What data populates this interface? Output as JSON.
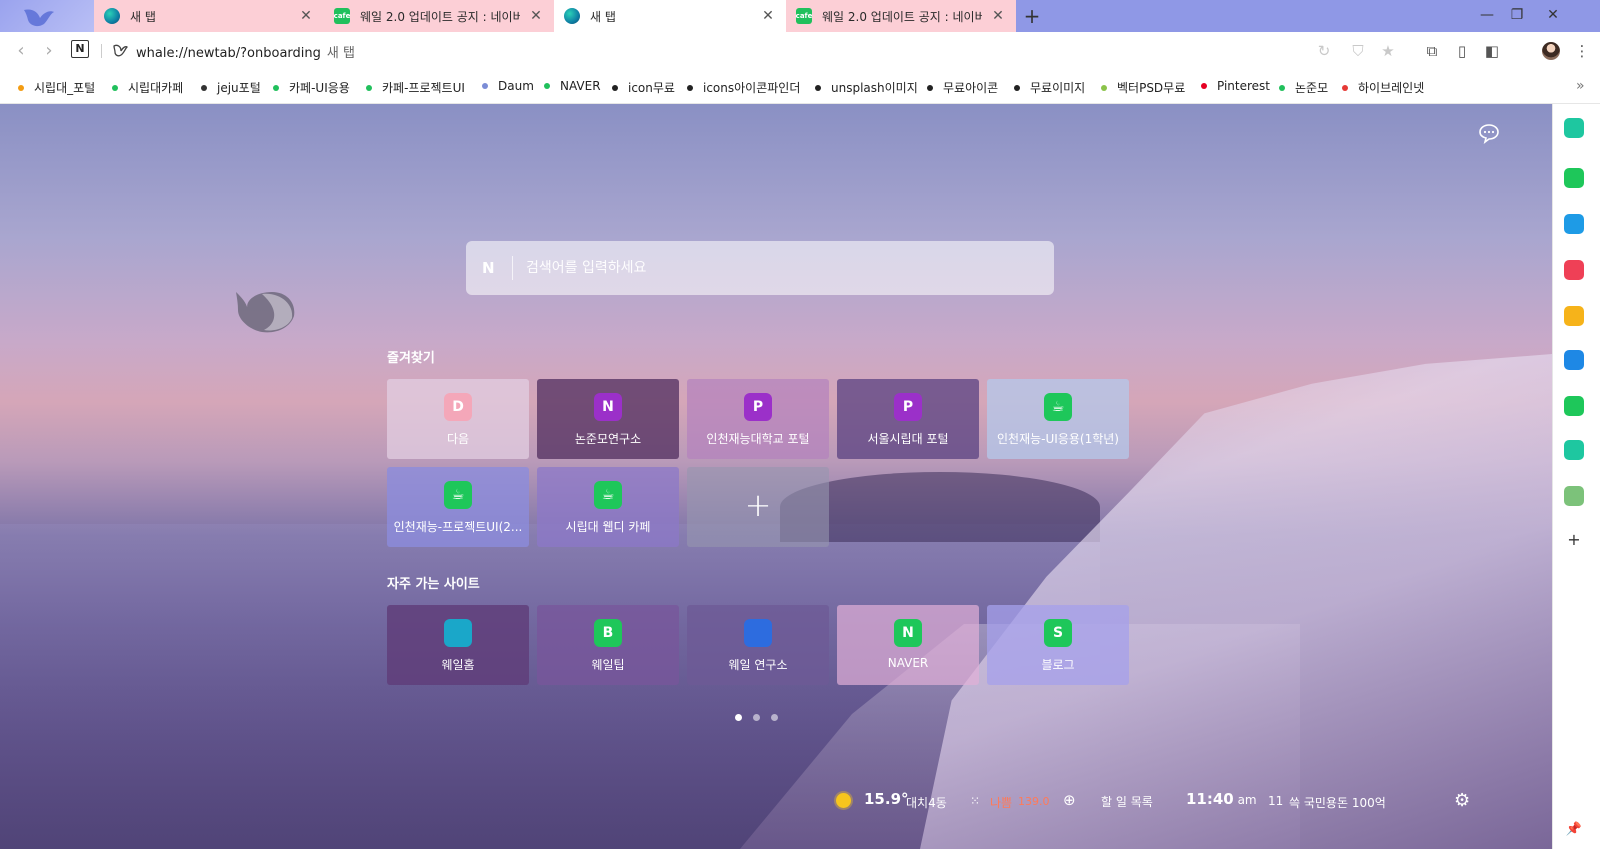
{
  "tabs": [
    {
      "title": "새 탭",
      "icon": "whale-icon"
    },
    {
      "title": "웨일 2.0 업데이트 공지 : 네이버",
      "icon": "cafe-icon"
    },
    {
      "title": "새 탭",
      "icon": "whale-icon"
    },
    {
      "title": "웨일 2.0 업데이트 공지 : 네이버",
      "icon": "cafe-icon"
    }
  ],
  "cafe_icon_text": "cafe",
  "address": {
    "url": "whale://newtab/?onboarding",
    "page_label": "새 탭",
    "n_label": "N"
  },
  "bookmarks": [
    {
      "label": "시립대_포털",
      "color": "#f39c12"
    },
    {
      "label": "시립대카페",
      "color": "#21c05c"
    },
    {
      "label": "jeju포털",
      "color": "#333333"
    },
    {
      "label": "카페-UI응용",
      "color": "#21c05c"
    },
    {
      "label": "카페-프로젝트UI",
      "color": "#21c05c"
    },
    {
      "label": "Daum",
      "color": "#7b8cd6"
    },
    {
      "label": "NAVER",
      "color": "#21c05c"
    },
    {
      "label": "icon무료",
      "color": "#222222"
    },
    {
      "label": "icons아이콘파인더",
      "color": "#222222"
    },
    {
      "label": "unsplash이미지",
      "color": "#222222"
    },
    {
      "label": "무료아이콘",
      "color": "#222222"
    },
    {
      "label": "무료이미지",
      "color": "#222222"
    },
    {
      "label": "벡터PSD무료",
      "color": "#8bc34a"
    },
    {
      "label": "Pinterest",
      "color": "#e60023"
    },
    {
      "label": "논준모",
      "color": "#21c05c"
    },
    {
      "label": "하이브레인넷",
      "color": "#e53935"
    }
  ],
  "search": {
    "logo": "N",
    "placeholder": "검색어를 입력하세요"
  },
  "favorites": {
    "title": "즐겨찾기",
    "items": [
      {
        "label": "다음",
        "glyph": "D",
        "color": "#f4a7b9"
      },
      {
        "label": "논준모연구소",
        "glyph": "N",
        "color": "#9b30c9"
      },
      {
        "label": "인천재능대학교 포털",
        "glyph": "P",
        "color": "#9b30c9"
      },
      {
        "label": "서울시립대 포털",
        "glyph": "P",
        "color": "#9b30c9"
      },
      {
        "label": "인천재능-UI응용(1학년)",
        "glyph": "☕",
        "color": "#1ec75a"
      },
      {
        "label": "인천재능-프로젝트UI(2...",
        "glyph": "☕",
        "color": "#1ec75a"
      },
      {
        "label": "시립대 웹디 카페",
        "glyph": "☕",
        "color": "#1ec75a"
      },
      {
        "label": "",
        "glyph": "+",
        "color": ""
      }
    ]
  },
  "frequent": {
    "title": "자주 가는 사이트",
    "items": [
      {
        "label": "웨일홈",
        "glyph": "",
        "color": "#1aa7c9"
      },
      {
        "label": "웨일팁",
        "glyph": "B",
        "color": "#1ec75a"
      },
      {
        "label": "웨일 연구소",
        "glyph": "",
        "color": "#2d6cdf"
      },
      {
        "label": "NAVER",
        "glyph": "N",
        "color": "#1ec75a"
      },
      {
        "label": "블로그",
        "glyph": "S",
        "color": "#1ec75a"
      }
    ]
  },
  "pager": {
    "count": 3,
    "active": 0
  },
  "status": {
    "temperature": "15.9°",
    "location": "대치4동",
    "air_label": "나쁨",
    "air_value": "139.0",
    "todo": "할 일 목록",
    "time": "11:40",
    "ampm": "am",
    "news_num": "11",
    "news_text": "쓱 국민용돈 100억"
  },
  "sidebar_icons": [
    {
      "name": "whale-talk-icon",
      "color": "#1ec7a0"
    },
    {
      "name": "alarm-icon",
      "color": "#1ec75a"
    },
    {
      "name": "calendar-icon",
      "color": "#1e9be6"
    },
    {
      "name": "pocket-icon",
      "color": "#ef4056"
    },
    {
      "name": "star-bookmark-icon",
      "color": "#f6b31a"
    },
    {
      "name": "translate-icon",
      "color": "#1e88e5"
    },
    {
      "name": "green-app-icon",
      "color": "#1ec75a"
    },
    {
      "name": "play-icon",
      "color": "#1ec7a0"
    },
    {
      "name": "character-icon",
      "color": "#7cc27a"
    }
  ],
  "colors": {
    "tab_inactive": "#fccfd6",
    "tab_strip": "#8f98e6",
    "air_bad": "#ff7a59"
  }
}
